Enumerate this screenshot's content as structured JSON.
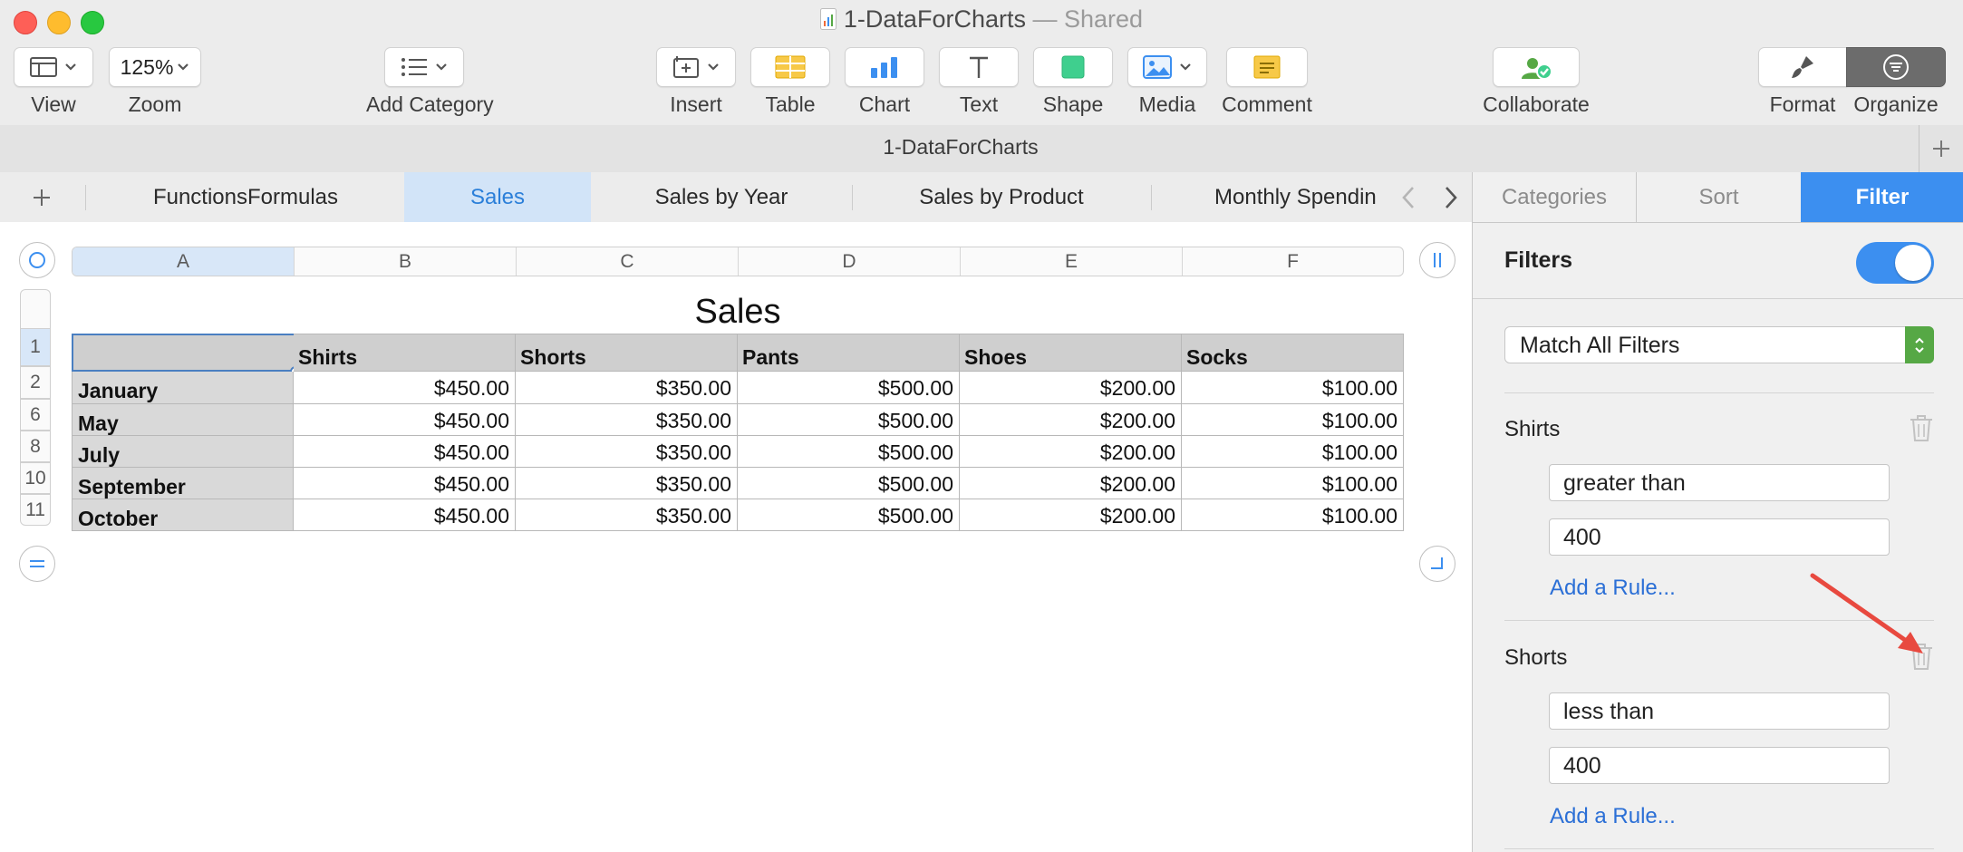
{
  "window": {
    "title": "1-DataForCharts",
    "shared_label": "— Shared"
  },
  "toolbar": {
    "view": "View",
    "zoom": "Zoom",
    "zoom_value": "125%",
    "add_category": "Add Category",
    "insert": "Insert",
    "table": "Table",
    "chart": "Chart",
    "text": "Text",
    "shape": "Shape",
    "media": "Media",
    "comment": "Comment",
    "collaborate": "Collaborate",
    "format": "Format",
    "organize": "Organize"
  },
  "doc_title": "1-DataForCharts",
  "sheet_tabs": [
    "FunctionsFormulas",
    "Sales",
    "Sales by Year",
    "Sales by Product",
    "Monthly Spendin"
  ],
  "active_tab": "Sales",
  "sidebar": {
    "tabs": [
      "Categories",
      "Sort",
      "Filter"
    ],
    "active_tab": "Filter",
    "filters_label": "Filters",
    "filters_enabled": true,
    "match_mode": "Match All Filters",
    "rules": [
      {
        "column": "Shirts",
        "condition": "greater than",
        "value": "400",
        "add_rule": "Add a Rule..."
      },
      {
        "column": "Shorts",
        "condition": "less than",
        "value": "400",
        "add_rule": "Add a Rule..."
      }
    ]
  },
  "sheet": {
    "title": "Sales",
    "column_letters": [
      "A",
      "B",
      "C",
      "D",
      "E",
      "F"
    ],
    "row_numbers": [
      "1",
      "2",
      "6",
      "8",
      "10",
      "11"
    ],
    "header_row": [
      "",
      "Shirts",
      "Shorts",
      "Pants",
      "Shoes",
      "Socks"
    ],
    "rows": [
      {
        "label": "January",
        "values": [
          "$450.00",
          "$350.00",
          "$500.00",
          "$200.00",
          "$100.00"
        ]
      },
      {
        "label": "May",
        "values": [
          "$450.00",
          "$350.00",
          "$500.00",
          "$200.00",
          "$100.00"
        ]
      },
      {
        "label": "July",
        "values": [
          "$450.00",
          "$350.00",
          "$500.00",
          "$200.00",
          "$100.00"
        ]
      },
      {
        "label": "September",
        "values": [
          "$450.00",
          "$350.00",
          "$500.00",
          "$200.00",
          "$100.00"
        ]
      },
      {
        "label": "October",
        "values": [
          "$450.00",
          "$350.00",
          "$500.00",
          "$200.00",
          "$100.00"
        ]
      }
    ]
  },
  "colors": {
    "accent": "#3c8ff0",
    "link": "#2b6fd6",
    "annotation_arrow": "#e8493f"
  }
}
